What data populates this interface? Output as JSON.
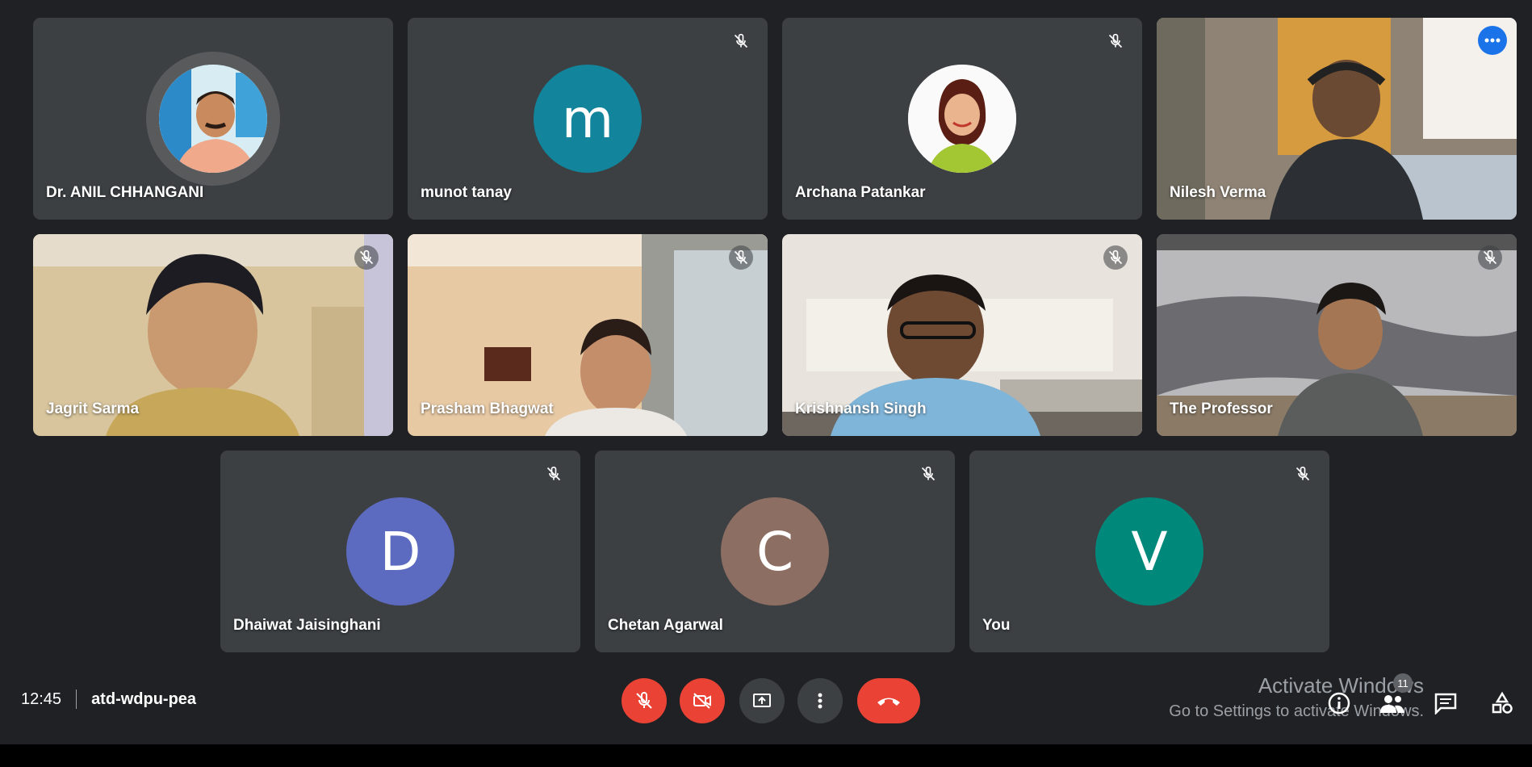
{
  "participants": [
    {
      "name": "Dr. ANIL CHHANGANI",
      "type": "photo-avatar",
      "muted": false
    },
    {
      "name": "munot tanay",
      "type": "letter-avatar",
      "initial": "m",
      "color": "#12849c",
      "muted": true
    },
    {
      "name": "Archana Patankar",
      "type": "photo-avatar",
      "muted": true
    },
    {
      "name": "Nilesh Verma",
      "type": "video",
      "muted": false,
      "active_speaker": true
    },
    {
      "name": "Jagrit Sarma",
      "type": "video",
      "muted": true
    },
    {
      "name": "Prasham Bhagwat",
      "type": "video",
      "muted": true
    },
    {
      "name": "Krishnansh Singh",
      "type": "video",
      "muted": true
    },
    {
      "name": "The Professor",
      "type": "video",
      "muted": true
    },
    {
      "name": "Dhaiwat Jaisinghani",
      "type": "letter-avatar",
      "initial": "D",
      "color": "#5c6bc0",
      "muted": true
    },
    {
      "name": "Chetan Agarwal",
      "type": "letter-avatar",
      "initial": "C",
      "color": "#8d6e63",
      "muted": true
    },
    {
      "name": "You",
      "type": "letter-avatar",
      "initial": "V",
      "color": "#00897b",
      "muted": true
    }
  ],
  "meeting": {
    "time": "12:45",
    "code": "atd-wdpu-pea"
  },
  "controls": [
    "microphone-off",
    "camera-off",
    "present-screen",
    "more-options",
    "leave-call"
  ],
  "side_panel": {
    "people_count": "11"
  },
  "watermark": {
    "line1": "Activate Windows",
    "line2": "Go to Settings to activate Windows."
  }
}
